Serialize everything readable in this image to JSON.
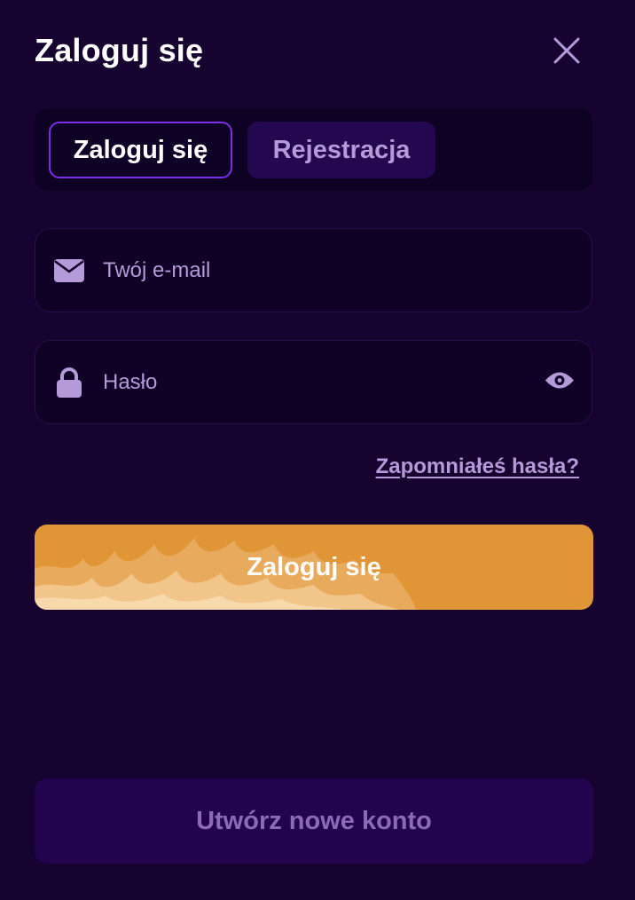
{
  "header": {
    "title": "Zaloguj się",
    "close_icon": "close-icon"
  },
  "tabs": [
    {
      "label": "Zaloguj się",
      "active": true
    },
    {
      "label": "Rejestracja",
      "active": false
    }
  ],
  "form": {
    "email": {
      "placeholder": "Twój e-mail",
      "value": "",
      "icon": "envelope-icon"
    },
    "password": {
      "placeholder": "Hasło",
      "value": "",
      "icon": "lock-icon",
      "toggle_icon": "eye-icon"
    },
    "forgot_link": "Zapomniałeś hasła?",
    "submit_label": "Zaloguj się"
  },
  "footer": {
    "create_account_label": "Utwórz nowe konto"
  },
  "colors": {
    "background": "#16032f",
    "accent": "#7b2ee6",
    "primary_button": "#e09636",
    "muted_text": "#b49ad8"
  }
}
